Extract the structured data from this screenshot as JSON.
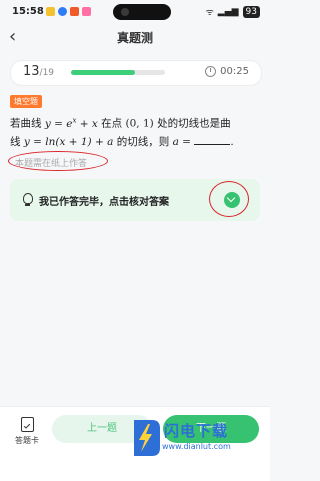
{
  "status": {
    "time": "15:58",
    "battery": "93",
    "notif_colors": [
      "#f2c230",
      "#2f7cf6",
      "#f05a29",
      "#ff6fa5"
    ]
  },
  "header": {
    "title": "真题测"
  },
  "progress": {
    "current": "13",
    "total": "/19",
    "fraction": 0.68,
    "timer": "00:25"
  },
  "question": {
    "type_tag": "填空题",
    "line1_a": "若曲线 ",
    "curve1": "y = e",
    "curve1_exp": "x",
    "curve1_b": " + x",
    "line1_b": " 在点 ",
    "point": "(0, 1)",
    "line1_c": " 处的切线也是曲",
    "line2_a": "线 ",
    "curve2": "y = ln(x + 1) + a",
    "line2_b": " 的切线，则 ",
    "var": "a",
    "line2_c": " = ",
    "line2_end": "."
  },
  "hint": "本题需在纸上作答",
  "check": {
    "text": "我已作答完毕，点击核对答案"
  },
  "bottom": {
    "card_label": "答题卡",
    "prev_label": "上一题",
    "next_label": "下一题"
  },
  "watermark": {
    "title": "闪电下载",
    "url": "www.dianlut.com"
  },
  "colors": {
    "accent": "#36c270",
    "annotation": "#d9252a",
    "tag": "#ff7a2e"
  }
}
